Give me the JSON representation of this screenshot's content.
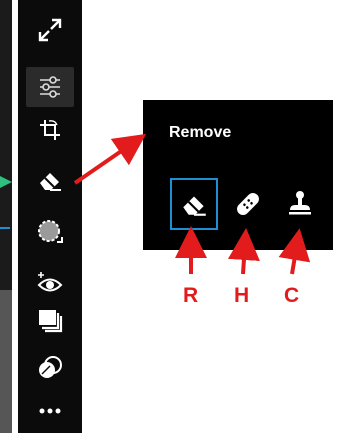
{
  "toolbar": {
    "tools": [
      {
        "icon": "expand-icon"
      },
      {
        "icon": "adjustments-icon"
      },
      {
        "icon": "crop-icon"
      },
      {
        "icon": "eraser-icon"
      },
      {
        "icon": "selection-icon"
      },
      {
        "icon": "red-eye-icon"
      },
      {
        "icon": "layers-icon"
      },
      {
        "icon": "blend-icon"
      },
      {
        "icon": "more-icon"
      }
    ]
  },
  "popup": {
    "title": "Remove",
    "options": [
      {
        "icon": "eraser-icon",
        "selected": true
      },
      {
        "icon": "bandage-icon",
        "selected": false
      },
      {
        "icon": "stamp-icon",
        "selected": false
      }
    ]
  },
  "annotations": {
    "labels": [
      "R",
      "H",
      "C"
    ],
    "arrow_color": "#e21c1c"
  },
  "colors": {
    "toolbar_bg": "#0b0b0b",
    "popup_bg": "#000000",
    "selection_outline": "#1f8fd2",
    "annotation": "#e21c1c"
  }
}
